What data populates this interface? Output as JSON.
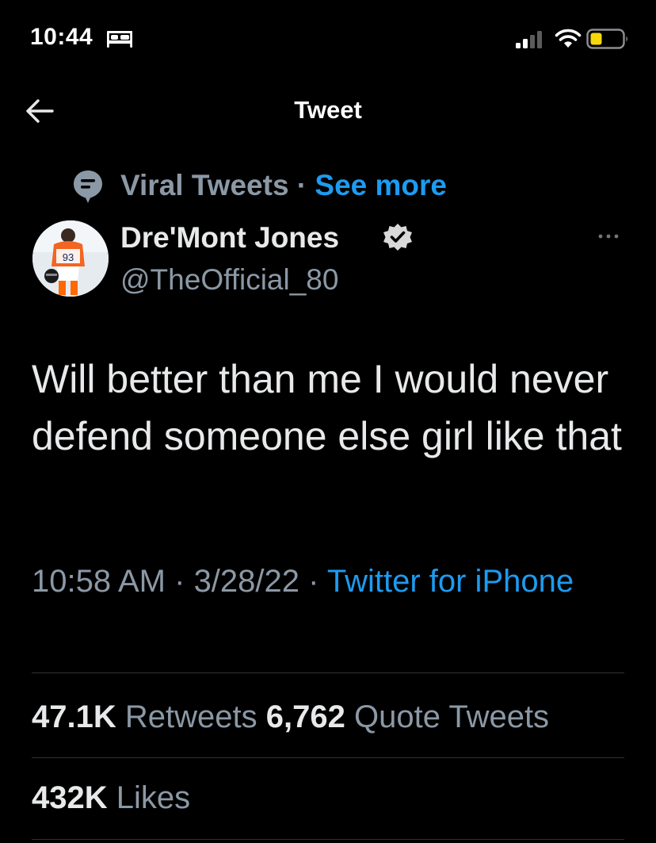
{
  "status_bar": {
    "time": "10:44",
    "sleep_icon": "bed-icon",
    "signal_icon": "cellular-signal-icon",
    "wifi_icon": "wifi-icon",
    "battery_icon": "battery-low-power-icon",
    "battery_color": "#f5d90a"
  },
  "header": {
    "back_icon": "arrow-left-icon",
    "title": "Tweet"
  },
  "context": {
    "icon": "topic-bubble-icon",
    "topic": "Viral Tweets",
    "separator": " · ",
    "link": "See more"
  },
  "author": {
    "avatar_icon": "profile-avatar",
    "name": "Dre'Mont Jones",
    "verified_icon": "verified-badge-icon",
    "handle": "@TheOfficial_80",
    "more_icon": "more-options-icon"
  },
  "tweet": {
    "text": "Will better than me I would never defend someone else girl like that",
    "time": "10:58 AM",
    "sep1": " · ",
    "date": "3/28/22",
    "sep2": " · ",
    "source": "Twitter for iPhone"
  },
  "stats": {
    "retweets_count": "47.1K",
    "retweets_label": "Retweets",
    "quotes_count": "6,762",
    "quotes_label": "Quote Tweets",
    "likes_count": "432K",
    "likes_label": "Likes"
  },
  "colors": {
    "background": "#000000",
    "text": "#e7e9ea",
    "secondary": "#8b98a5",
    "accent": "#1d9bf0",
    "divider": "#2f3336"
  }
}
